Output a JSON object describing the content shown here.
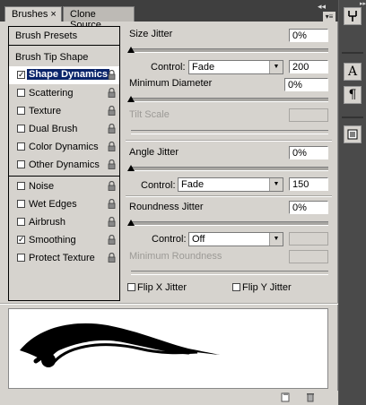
{
  "tabs": [
    {
      "label": "Brushes",
      "close": "×"
    },
    {
      "label": "Clone Source"
    }
  ],
  "panel_menu": {
    "collapse": "◂◂",
    "menu": "▾≡"
  },
  "brush_list": {
    "presets_label": "Brush Presets",
    "tip_shape_label": "Brush Tip Shape",
    "options": [
      {
        "label": "Shape Dynamics",
        "checked": true,
        "selected": true
      },
      {
        "label": "Scattering",
        "checked": false
      },
      {
        "label": "Texture",
        "checked": false
      },
      {
        "label": "Dual Brush",
        "checked": false
      },
      {
        "label": "Color Dynamics",
        "checked": false
      },
      {
        "label": "Other Dynamics",
        "checked": false
      },
      {
        "label": "Noise",
        "checked": false
      },
      {
        "label": "Wet Edges",
        "checked": false
      },
      {
        "label": "Airbrush",
        "checked": false
      },
      {
        "label": "Smoothing",
        "checked": true
      },
      {
        "label": "Protect Texture",
        "checked": false
      }
    ]
  },
  "settings": {
    "size_jitter": {
      "label": "Size Jitter",
      "value": "0%"
    },
    "size_control": {
      "label": "Control:",
      "value": "Fade",
      "steps": "200"
    },
    "minimum_diameter": {
      "label": "Minimum Diameter",
      "value": "0%"
    },
    "tilt_scale": {
      "label": "Tilt Scale"
    },
    "angle_jitter": {
      "label": "Angle Jitter",
      "value": "0%"
    },
    "angle_control": {
      "label": "Control:",
      "value": "Fade",
      "steps": "150"
    },
    "roundness_jitter": {
      "label": "Roundness Jitter",
      "value": "0%"
    },
    "roundness_control": {
      "label": "Control:",
      "value": "Off"
    },
    "minimum_roundness": {
      "label": "Minimum Roundness"
    },
    "flip_x": {
      "label": "Flip X Jitter"
    },
    "flip_y": {
      "label": "Flip Y Jitter"
    }
  },
  "dock": {
    "icons": [
      "brushes-icon",
      "type-icon",
      "paragraph-icon",
      "notes-icon"
    ],
    "type_glyph": "A",
    "para_glyph": "¶"
  },
  "colors": {
    "panel": "#d6d3ce",
    "selection": "#0a246a",
    "tabbar": "#3f3f3f"
  }
}
